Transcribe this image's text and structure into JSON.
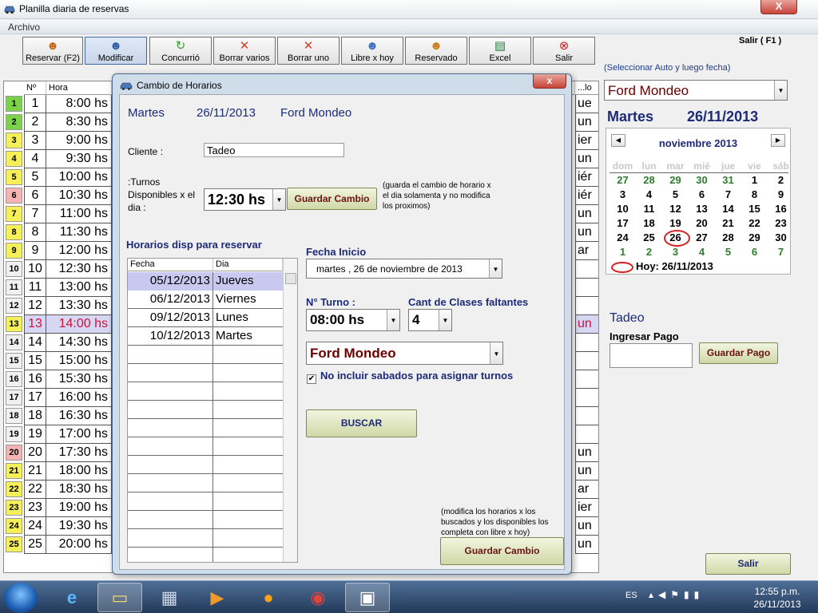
{
  "window": {
    "title": "Planilla diaria de reservas",
    "close_glyph": "X"
  },
  "menu": {
    "archivo": "Archivo"
  },
  "toolbar": [
    {
      "label": "Reservar (F2)",
      "icon": "user-add-icon",
      "color": "#c26a1a"
    },
    {
      "label": "Modificar",
      "icon": "user-edit-icon",
      "color": "#2a5caa"
    },
    {
      "label": "Concurrió",
      "icon": "arrow-refresh-icon",
      "color": "#2f9c2f"
    },
    {
      "label": "Borrar varios",
      "icon": "x-icon",
      "color": "#d33d2a"
    },
    {
      "label": "Borrar uno",
      "icon": "x-icon",
      "color": "#d33d2a"
    },
    {
      "label": "Libre x hoy",
      "icon": "user-remove-icon",
      "color": "#3a6bbd"
    },
    {
      "label": "Reservado",
      "icon": "user-icon",
      "color": "#c87a1a"
    },
    {
      "label": "Excel",
      "icon": "excel-icon",
      "color": "#1e7b3a"
    },
    {
      "label": "Salir",
      "icon": "exit-icon",
      "color": "#c81e1e"
    }
  ],
  "salir_f1": "Salir ( F1 )",
  "hint": "(Seleccionar Auto y luego fecha)",
  "right": {
    "car": "Ford Mondeo",
    "day": "Martes",
    "date": "26/11/2013",
    "client": "Tadeo",
    "pago_label": "Ingresar Pago",
    "pago_button": "Guardar Pago",
    "salir": "Salir"
  },
  "calendar": {
    "month": "noviembre 2013",
    "prev": "◀",
    "next": "▶",
    "dow": [
      "dom",
      "lun",
      "mar",
      "mié",
      "jue",
      "vie",
      "sáb"
    ],
    "weeks": [
      [
        "27",
        "28",
        "29",
        "30",
        "31",
        "1",
        "2"
      ],
      [
        "3",
        "4",
        "5",
        "6",
        "7",
        "8",
        "9"
      ],
      [
        "10",
        "11",
        "12",
        "13",
        "14",
        "15",
        "16"
      ],
      [
        "17",
        "18",
        "19",
        "20",
        "21",
        "22",
        "23"
      ],
      [
        "24",
        "25",
        "26",
        "27",
        "28",
        "29",
        "30"
      ],
      [
        "1",
        "2",
        "3",
        "4",
        "5",
        "6",
        "7"
      ]
    ],
    "today_label": "Hoy: 26/11/2013"
  },
  "grid": {
    "headers": {
      "no": "Nº",
      "hora": "Hora",
      "tail": "...lo"
    },
    "rows": [
      {
        "idx": "1",
        "no": "1",
        "hora": "8:00 hs",
        "tail": "ue",
        "color": "#7cd24a"
      },
      {
        "idx": "2",
        "no": "2",
        "hora": "8:30 hs",
        "tail": "un",
        "color": "#7cd24a"
      },
      {
        "idx": "3",
        "no": "3",
        "hora": "9:00 hs",
        "tail": "ier",
        "color": "#f5ef5a"
      },
      {
        "idx": "4",
        "no": "4",
        "hora": "9:30 hs",
        "tail": "un",
        "color": "#f5ef5a"
      },
      {
        "idx": "5",
        "no": "5",
        "hora": "10:00 hs",
        "tail": "iér",
        "color": "#f5ef5a"
      },
      {
        "idx": "6",
        "no": "6",
        "hora": "10:30 hs",
        "tail": "iér",
        "color": "#f4b4b4"
      },
      {
        "idx": "7",
        "no": "7",
        "hora": "11:00 hs",
        "tail": "un",
        "color": "#f5ef5a"
      },
      {
        "idx": "8",
        "no": "8",
        "hora": "11:30 hs",
        "tail": "un",
        "color": "#f5ef5a"
      },
      {
        "idx": "9",
        "no": "9",
        "hora": "12:00 hs",
        "tail": "ar",
        "color": "#f5ef5a"
      },
      {
        "idx": "10",
        "no": "10",
        "hora": "12:30 hs",
        "tail": "",
        "color": "#f0f0f0"
      },
      {
        "idx": "11",
        "no": "11",
        "hora": "13:00 hs",
        "tail": "",
        "color": "#f0f0f0"
      },
      {
        "idx": "12",
        "no": "12",
        "hora": "13:30 hs",
        "tail": "",
        "color": "#f0f0f0"
      },
      {
        "idx": "13",
        "no": "13",
        "hora": "14:00 hs",
        "tail": "un",
        "color": "#f5ef5a",
        "highlight": true
      },
      {
        "idx": "14",
        "no": "14",
        "hora": "14:30 hs",
        "tail": "",
        "color": "#f0f0f0"
      },
      {
        "idx": "15",
        "no": "15",
        "hora": "15:00 hs",
        "tail": "",
        "color": "#f0f0f0"
      },
      {
        "idx": "16",
        "no": "16",
        "hora": "15:30 hs",
        "tail": "",
        "color": "#f0f0f0"
      },
      {
        "idx": "17",
        "no": "17",
        "hora": "16:00 hs",
        "tail": "",
        "color": "#f0f0f0"
      },
      {
        "idx": "18",
        "no": "18",
        "hora": "16:30 hs",
        "tail": "",
        "color": "#f0f0f0"
      },
      {
        "idx": "19",
        "no": "19",
        "hora": "17:00 hs",
        "tail": "",
        "color": "#f0f0f0"
      },
      {
        "idx": "20",
        "no": "20",
        "hora": "17:30 hs",
        "tail": "un",
        "color": "#f4b4b4"
      },
      {
        "idx": "21",
        "no": "21",
        "hora": "18:00 hs",
        "tail": "un",
        "color": "#f5ef5a"
      },
      {
        "idx": "22",
        "no": "22",
        "hora": "18:30 hs",
        "tail": "ar",
        "color": "#f5ef5a"
      },
      {
        "idx": "23",
        "no": "23",
        "hora": "19:00 hs",
        "tail": "ier",
        "color": "#f5ef5a"
      },
      {
        "idx": "24",
        "no": "24",
        "hora": "19:30 hs",
        "tail": "un",
        "color": "#f5ef5a"
      },
      {
        "idx": "25",
        "no": "25",
        "hora": "20:00 hs",
        "tail": "un",
        "color": "#f5ef5a"
      }
    ]
  },
  "dialog": {
    "title": "Cambio de Horarios",
    "close_glyph": "x",
    "day": "Martes",
    "date": "26/11/2013",
    "car": "Ford Mondeo",
    "cliente_label": "Cliente :",
    "cliente": "Tadeo",
    "turnos_label": ":Turnos Disponibles x el dia :",
    "turno": "12:30 hs",
    "guardar_cambio": "Guardar Cambio",
    "note1": "(guarda el cambio de horario x el dia solamenta y no modifica los proximos)",
    "horarios_label": "Horarios disp para reservar",
    "table_headers": {
      "fecha": "Fecha",
      "dia": "Dia"
    },
    "table_rows": [
      {
        "fecha": "05/12/2013",
        "dia": "Jueves"
      },
      {
        "fecha": "06/12/2013",
        "dia": "Viernes"
      },
      {
        "fecha": "09/12/2013",
        "dia": "Lunes"
      },
      {
        "fecha": "10/12/2013",
        "dia": "Martes"
      }
    ],
    "fecha_inicio_label": "Fecha Inicio",
    "fecha_inicio": "martes , 26 de noviembre de 2013",
    "nturno_label": "N° Turno :",
    "nturno": "08:00 hs",
    "cant_label": "Cant de Clases faltantes",
    "cant": "4",
    "car_select": "Ford Mondeo",
    "check_label": "No incluir sabados para asignar turnos",
    "buscar": "BUSCAR",
    "note2": "(modifica los horarios x los buscados y los disponibles los completa con libre x hoy)",
    "guardar_cambio2": "Guardar Cambio"
  },
  "taskbar": {
    "lang": "ES",
    "time": "12:55 p.m.",
    "date": "26/11/2013"
  }
}
